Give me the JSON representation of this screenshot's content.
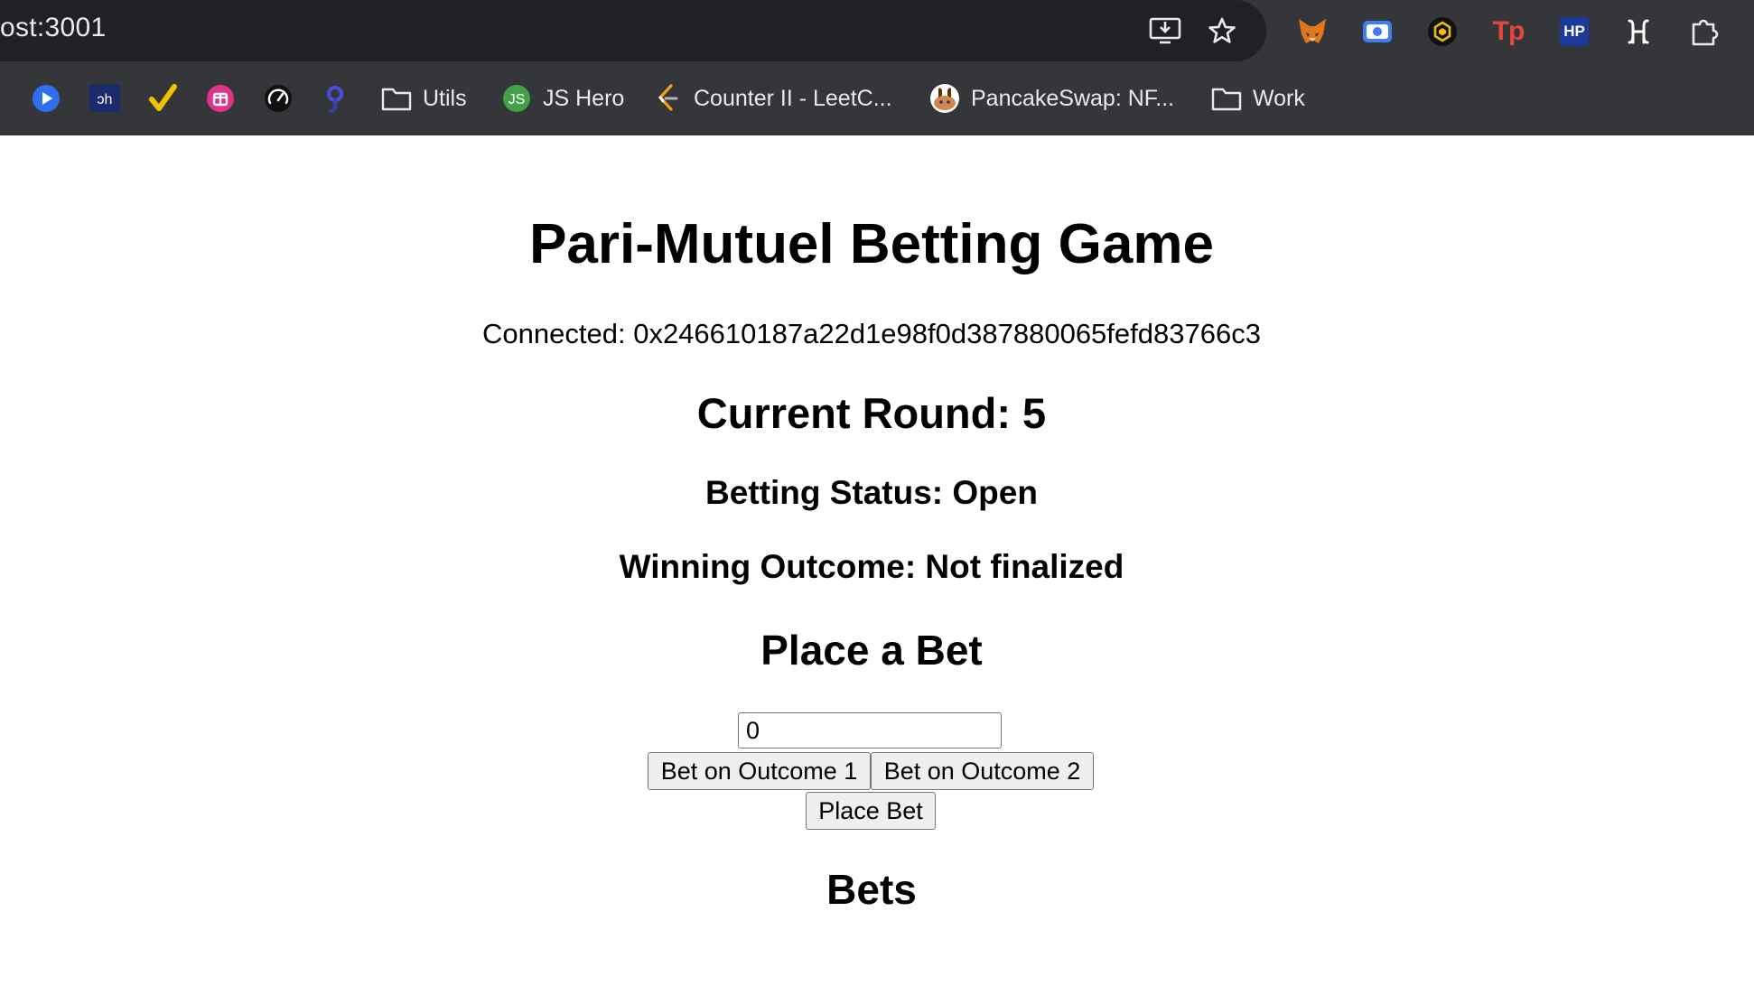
{
  "browser": {
    "url": "ost:3001",
    "omnibox_icons": [
      "install-icon",
      "star-icon"
    ],
    "extensions": [
      {
        "name": "metamask-fox-icon",
        "color": "#e2761b"
      },
      {
        "name": "screen-record-icon",
        "color": "#3d7df6"
      },
      {
        "name": "bnb-wallet-icon",
        "color": "#f0b90b"
      },
      {
        "name": "tokenpocket-icon",
        "label": "Tp",
        "color": "#e8453c"
      },
      {
        "name": "hp-icon",
        "label": "HP",
        "color": "#1a3a9c"
      },
      {
        "name": "hashnode-icon",
        "color": "#ffffff"
      },
      {
        "name": "puzzle-extensions-icon",
        "color": "#e8eaed"
      }
    ],
    "bookmarks": [
      {
        "name": "play-icon",
        "label": "",
        "color": "#2f6fed"
      },
      {
        "name": "dh-icon",
        "label": "",
        "color": "#1b2a6b"
      },
      {
        "name": "checkmark-icon",
        "label": "",
        "color": "#f2c200"
      },
      {
        "name": "calendar-gift-icon",
        "label": "",
        "color": "#e0338a"
      },
      {
        "name": "speedometer-icon",
        "label": "",
        "color": "#ffffff"
      },
      {
        "name": "hook-icon",
        "label": "",
        "color": "#4a4fd6"
      },
      {
        "name": "folder-icon",
        "label": "Utils",
        "color": "#e8eaed"
      },
      {
        "name": "js-hero-icon",
        "label": "JS Hero",
        "color": "#43a047"
      },
      {
        "name": "leetcode-icon",
        "label": "Counter II - LeetC...",
        "color": "#f89f1b"
      },
      {
        "name": "pancakeswap-icon",
        "label": "PancakeSwap: NF...",
        "color": "#d1884f"
      },
      {
        "name": "folder-icon",
        "label": "Work",
        "color": "#e8eaed"
      }
    ]
  },
  "app": {
    "title": "Pari-Mutuel Betting Game",
    "connected": "Connected: 0x246610187a22d1e98f0d387880065fefd83766c3",
    "current_round": "Current Round: 5",
    "betting_status": "Betting Status: Open",
    "winning_outcome": "Winning Outcome: Not finalized",
    "place_bet_heading": "Place a Bet",
    "bet_amount_value": "0",
    "bet_outcome_1_label": "Bet on Outcome 1",
    "bet_outcome_2_label": "Bet on Outcome 2",
    "place_bet_label": "Place Bet",
    "bets_heading": "Bets"
  }
}
